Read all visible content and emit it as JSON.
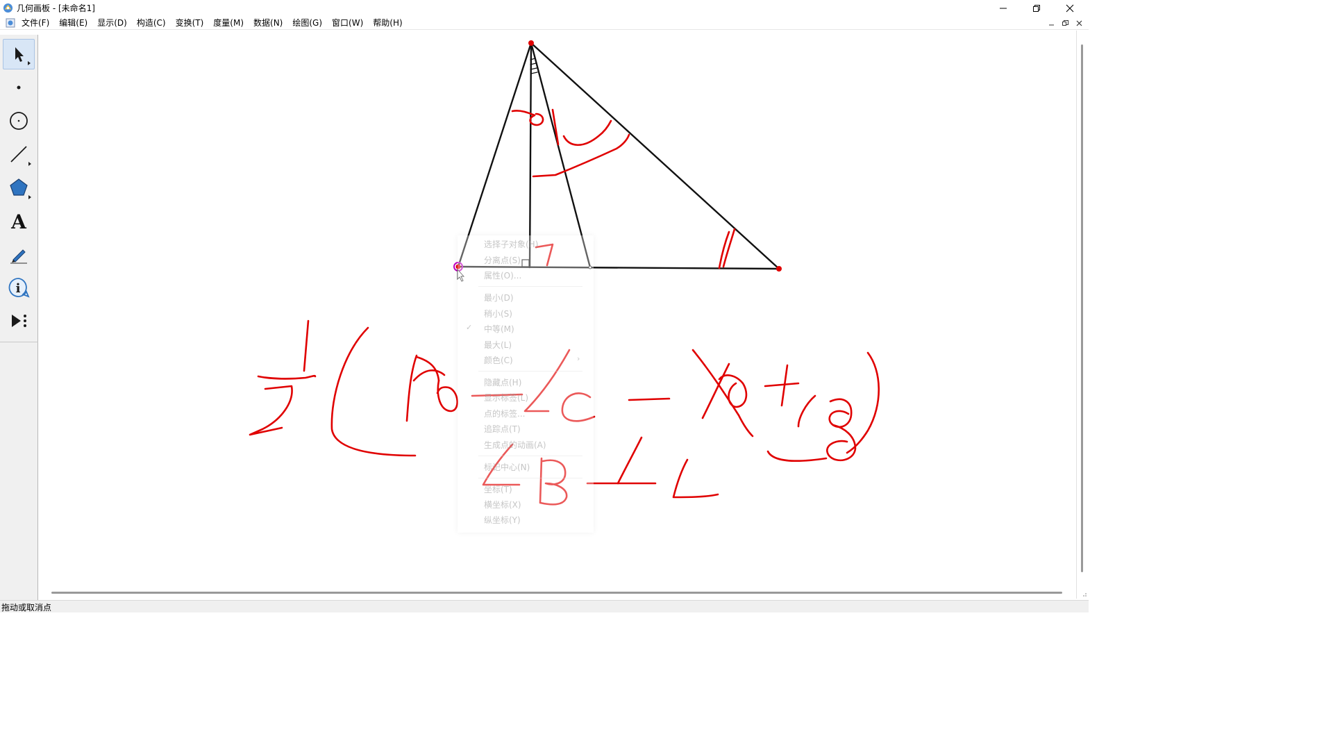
{
  "window": {
    "title": "几何画板 - [未命名1]"
  },
  "menubar": {
    "items": [
      "文件(F)",
      "编辑(E)",
      "显示(D)",
      "构造(C)",
      "变换(T)",
      "度量(M)",
      "数据(N)",
      "绘图(G)",
      "窗口(W)",
      "帮助(H)"
    ]
  },
  "toolbox": {
    "tools": [
      {
        "name": "arrow-select-tool",
        "icon": "arrow-icon",
        "active": true
      },
      {
        "name": "point-tool",
        "icon": "point-icon"
      },
      {
        "name": "compass-tool",
        "icon": "circle-icon"
      },
      {
        "name": "straightedge-tool",
        "icon": "segment-icon"
      },
      {
        "name": "polygon-tool",
        "icon": "polygon-icon"
      },
      {
        "name": "text-tool",
        "icon": "text-a-icon",
        "label": "A"
      },
      {
        "name": "marker-tool",
        "icon": "pen-icon"
      },
      {
        "name": "information-tool",
        "icon": "info-icon",
        "label": "i"
      },
      {
        "name": "custom-tool",
        "icon": "play-custom-icon"
      }
    ]
  },
  "context_menu": {
    "items": [
      {
        "label": "选择子对象(H)"
      },
      {
        "label": "分离点(S)"
      },
      {
        "label": "属性(O)..."
      },
      {
        "label": "最小(D)"
      },
      {
        "label": "稍小(S)"
      },
      {
        "label": "中等(M)",
        "checked": true
      },
      {
        "label": "最大(L)"
      },
      {
        "label": "颜色(C)",
        "submenu": true
      },
      {
        "label": "隐藏点(H)"
      },
      {
        "label": "显示标签(L)"
      },
      {
        "label": "点的标签..."
      },
      {
        "label": "追踪点(T)"
      },
      {
        "label": "生成点的动画(A)"
      },
      {
        "label": "标记中心(N)"
      },
      {
        "label": "坐标(T)"
      },
      {
        "label": "横坐标(X)"
      },
      {
        "label": "纵坐标(Y)"
      }
    ]
  },
  "colors": {
    "ink": "#e00000",
    "construction": "#111111",
    "point": "#e00000",
    "selected_point": "#c000c0"
  },
  "statusbar": {
    "text": "拖动或取消点"
  }
}
